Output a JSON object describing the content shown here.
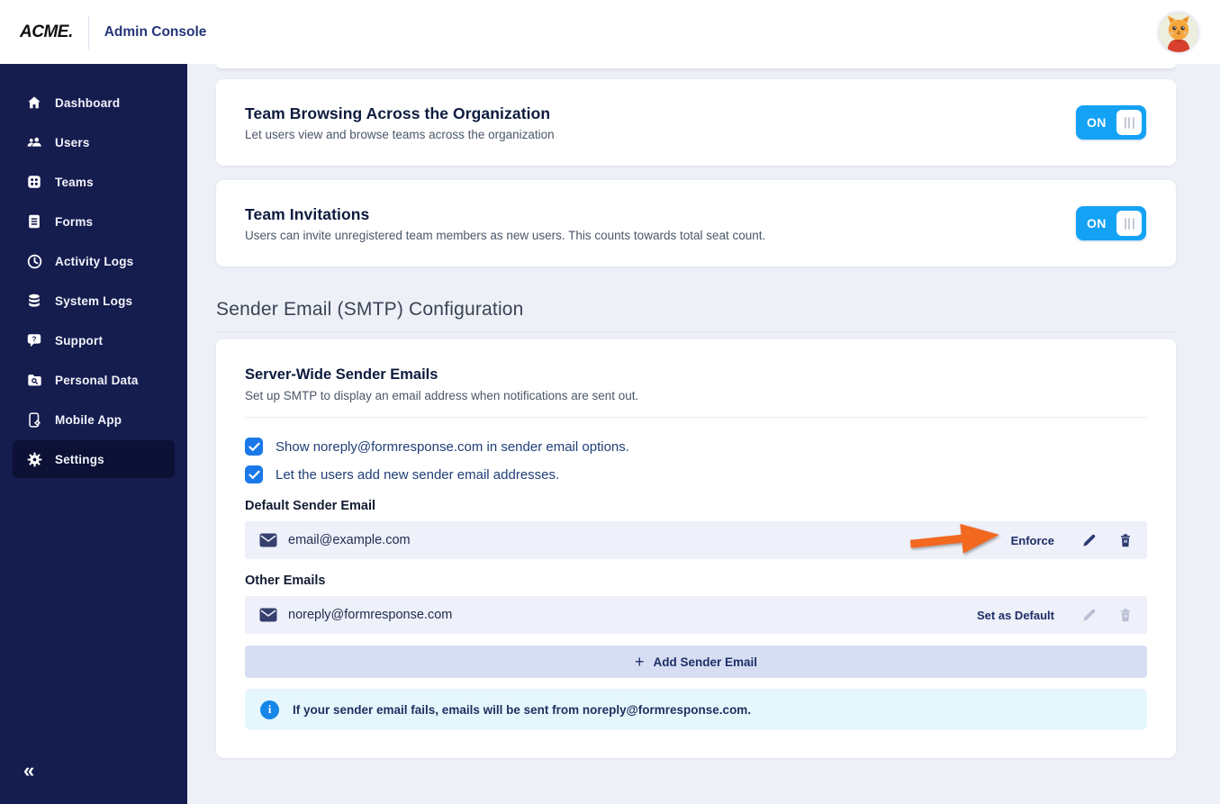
{
  "colors": {
    "sidebar_bg": "#151c4e",
    "sidebar_active_bg": "#0c1135",
    "toggle_blue": "#14a2f5",
    "checkbox_blue": "#1a78e8",
    "row_bg": "#eef0fa",
    "add_button_bg": "#d7def3",
    "info_banner_bg": "#e6f6fd",
    "info_icon_blue": "#1686e8",
    "arrow_orange": "#f2681f",
    "link_navy": "#1c2e66"
  },
  "header": {
    "logo_text": "ACME.",
    "title": "Admin Console",
    "avatar": "cat-avatar"
  },
  "sidebar": {
    "items": [
      {
        "label": "Dashboard",
        "icon": "home-icon",
        "active": false
      },
      {
        "label": "Users",
        "icon": "users-icon",
        "active": false
      },
      {
        "label": "Teams",
        "icon": "teams-grid-icon",
        "active": false
      },
      {
        "label": "Forms",
        "icon": "form-document-icon",
        "active": false
      },
      {
        "label": "Activity Logs",
        "icon": "clock-icon",
        "active": false
      },
      {
        "label": "System Logs",
        "icon": "database-icon",
        "active": false
      },
      {
        "label": "Support",
        "icon": "help-bubble-icon",
        "active": false
      },
      {
        "label": "Personal Data",
        "icon": "folder-search-icon",
        "active": false
      },
      {
        "label": "Mobile App",
        "icon": "mobile-phone-icon",
        "active": false
      },
      {
        "label": "Settings",
        "icon": "gear-icon",
        "active": true
      }
    ],
    "collapse_glyph": "«"
  },
  "toggles_section": {
    "cards": [
      {
        "title": "Team Browsing Across the Organization",
        "description": "Let users view and browse teams across the organization",
        "toggle": "ON",
        "toggle_state": "on"
      },
      {
        "title": "Team Invitations",
        "description": "Users can invite unregistered team members as new users. This counts towards total seat count.",
        "toggle": "ON",
        "toggle_state": "on"
      }
    ]
  },
  "smtp_section": {
    "heading": "Sender Email (SMTP) Configuration",
    "card": {
      "title": "Server-Wide Sender Emails",
      "description": "Set up SMTP to display an email address when notifications are sent out.",
      "checkboxes": [
        {
          "label": "Show noreply@formresponse.com in sender email options.",
          "checked": true
        },
        {
          "label": "Let the users add new sender email addresses.",
          "checked": true
        }
      ],
      "default_group_label": "Default Sender Email",
      "default_email": {
        "address": "email@example.com",
        "action": "Enforce"
      },
      "other_group_label": "Other Emails",
      "other_email": {
        "address": "noreply@formresponse.com",
        "action": "Set as Default"
      },
      "add_button_label": "Add Sender Email",
      "add_button_plus": "+",
      "info_text": "If your sender email fails, emails will be sent from noreply@formresponse.com."
    }
  }
}
